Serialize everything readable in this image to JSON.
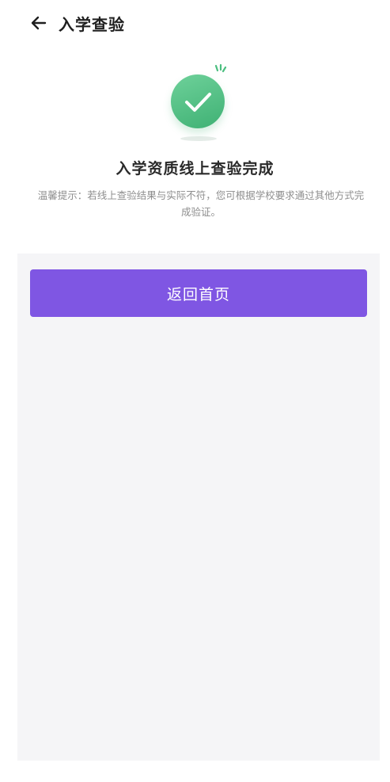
{
  "header": {
    "back_icon": "arrow-left-icon",
    "title": "入学查验"
  },
  "result": {
    "icon": "check-circle-icon",
    "title": "入学资质线上查验完成",
    "tip": "温馨提示：若线上查验结果与实际不符，您可根据学校要求通过其他方式完成验证。"
  },
  "actions": {
    "home_label": "返回首页"
  },
  "colors": {
    "accent": "#7f56e3",
    "success": "#4cbf80",
    "content_bg": "#f5f5f7"
  }
}
